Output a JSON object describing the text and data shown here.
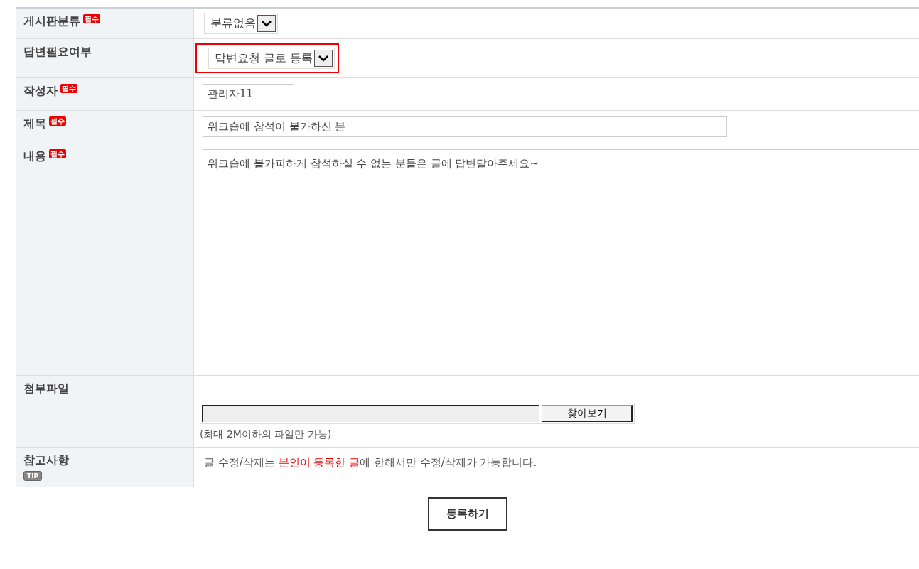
{
  "form": {
    "rows": [
      {
        "label": "게시판분류",
        "required_badge": "필수",
        "kind": "select",
        "value": "분류없음",
        "highlighted": false
      },
      {
        "label": "답변필요여부",
        "kind": "select",
        "value": "답변요청 글로 등록",
        "highlighted": true
      },
      {
        "label": "작성자",
        "required_badge": "필수",
        "kind": "input",
        "value": "관리자11"
      },
      {
        "label": "제목",
        "required_badge": "필수",
        "kind": "wide-input",
        "value": "워크숍에 참석이 불가하신 분"
      },
      {
        "label": "내용",
        "required_badge": "필수",
        "kind": "textarea",
        "value": "워크숍에 불가피하게 참석하실 수 없는 분들은 글에 답변달아주세요~"
      },
      {
        "label": "첨부파일",
        "kind": "file",
        "button": "찾아보기",
        "hint": "(최대 2M이하의 파일만 가능)"
      },
      {
        "label": "참고사항",
        "tip_badge": "TIP",
        "kind": "note",
        "segments": [
          {
            "text": "글 수정/삭제는 ",
            "emphasis": false
          },
          {
            "text": "본인이 등록한 글",
            "emphasis": true
          },
          {
            "text": "에 한해서만 수정/삭제가 가능합니다.",
            "emphasis": false
          }
        ]
      }
    ],
    "submit": "등록하기"
  }
}
